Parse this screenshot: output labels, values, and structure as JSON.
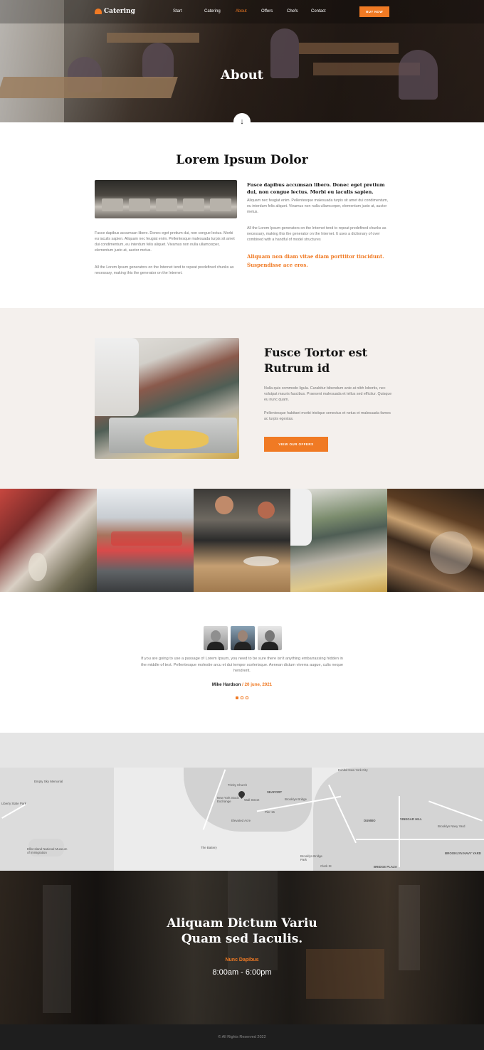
{
  "nav": {
    "logo": "Catering",
    "items": [
      "Start",
      "Catering",
      "About",
      "Offers",
      "Chefs",
      "Contact"
    ],
    "active": "About",
    "buy_label": "BUY NOW"
  },
  "hero": {
    "title": "About"
  },
  "intro": {
    "title": "Lorem Ipsum Dolor",
    "left_p1": "Fusce dapibus accumsan libero. Donec eget pretium dui, non congue lectus. Morbi eu iaculis sapien. Aliquam nec feugiat enim. Pellentesque malesuada turpis sit amet dui condimentum, eu interdum felis aliquet. Vivamus non nulla ullamcorper, elementum justo at, auctor metus.",
    "left_p2": "All the Lorem Ipsum generators on the Internet tend to repeat predefined chunks as necessary, making this the generator on the Internet.",
    "right_heading": "Fusce dapibus accumsan libero. Donec eget pretium dui, non congue lectus. Morbi eu iaculis sapien.",
    "right_p1": "Aliquam nec feugiat enim. Pellentesque malesuada turpis sit amet dui condimentum, eu interdum felis aliquet. Vivamus non nulla ullamcorper, elementum justo at, auctor metus.",
    "right_p2": "All the Lorem Ipsum generators on the Internet tend to repeat predefined chunks as necessary, making this the generator on the Internet. It uses a dictionary of over combined with a handful of model structures",
    "right_highlight": "Aliquam non diam vitae diam porttitor tincidunt. Suspendisse ace eros."
  },
  "feature": {
    "title": "Fusce Tortor est Rutrum id",
    "p1": "Nulla quis commodo ligula. Curabitur bibendum ante at nibh lobortis, nec volutpat mauris faucibus. Praesent malesuada et tellus sed efficitur. Quisque eu nunc quam.",
    "p2": "Pellentesque habitant morbi tristique senectus et netus et malesuada fames ac turpis egestas.",
    "button": "VIEW OUR OFFERS"
  },
  "testimonial": {
    "quote": "If you are going to use a passage of Lorem Ipsum, you need to be sure there isn't anything embarrassing hidden in the middle of text. Pellentesque molestie arcu et dui tempor scelerisque. Aenean dictum viverra augue, culis neque hendrerit.",
    "name": "Mike Hardson",
    "date": " / 20 june, 2021"
  },
  "map": {
    "labels": [
      "Empty Sky Memorial",
      "Liberty State Park",
      "Ellis Island National Museum of Immigration",
      "New York Stock Exchange",
      "Wall Street",
      "Trinity Church",
      "SEAPORT",
      "Brooklyn Bridge",
      "Pier 15",
      "Elevated Acre",
      "The Battery",
      "DUMBO",
      "VINEGAR HILL",
      "Brooklyn Navy Yard",
      "BROOKLYN NAVY YARD",
      "Brooklyn Bridge Park",
      "BRIDGE PLAZA",
      "Exhibit New York City",
      "Clark St"
    ]
  },
  "hours": {
    "title_line1": "Aliquam Dictum Variu",
    "title_line2": "Quam sed Iaculis.",
    "tag": "Nunc Dapibus",
    "time": "8:00am - 6:00pm"
  },
  "footer": {
    "text": "© All Rights Reserved 2022"
  },
  "colors": {
    "accent": "#f07a24",
    "beige": "#f4f0ed",
    "footer": "#1e1e1e"
  }
}
